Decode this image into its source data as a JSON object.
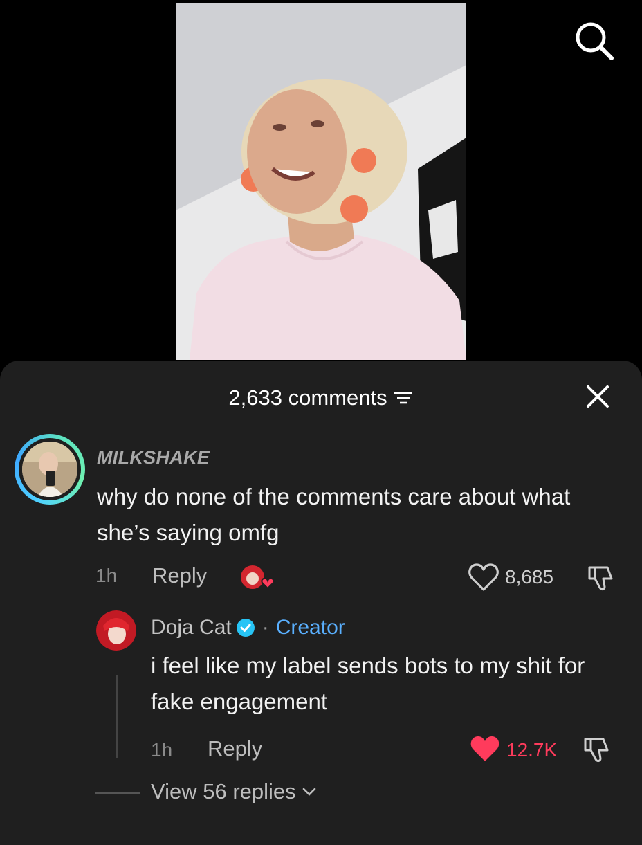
{
  "header": {
    "comments_label": "2,633 comments"
  },
  "icons": {
    "search": "search-icon",
    "filter": "filter-icon",
    "close": "close-icon",
    "heart": "heart-icon",
    "dislike": "dislike-icon",
    "verified": "verified-badge-icon",
    "chevron": "chevron-down-icon"
  },
  "colors": {
    "sheet_bg": "#1f1f1f",
    "creator_blue": "#5ab0ff",
    "like_red": "#ff3b5c"
  },
  "comment": {
    "username": "MILKSHAKE",
    "text": "why do none of the comments care about what she’s saying omfg",
    "time": "1h",
    "reply_label": "Reply",
    "like_count": "8,685"
  },
  "reply": {
    "author": "Doja Cat",
    "separator": "·",
    "badge": "Creator",
    "text": "i feel like my label sends bots to my shit for fake engagement",
    "time": "1h",
    "reply_label": "Reply",
    "like_count": "12.7K"
  },
  "view_replies": {
    "label": "View 56 replies"
  }
}
